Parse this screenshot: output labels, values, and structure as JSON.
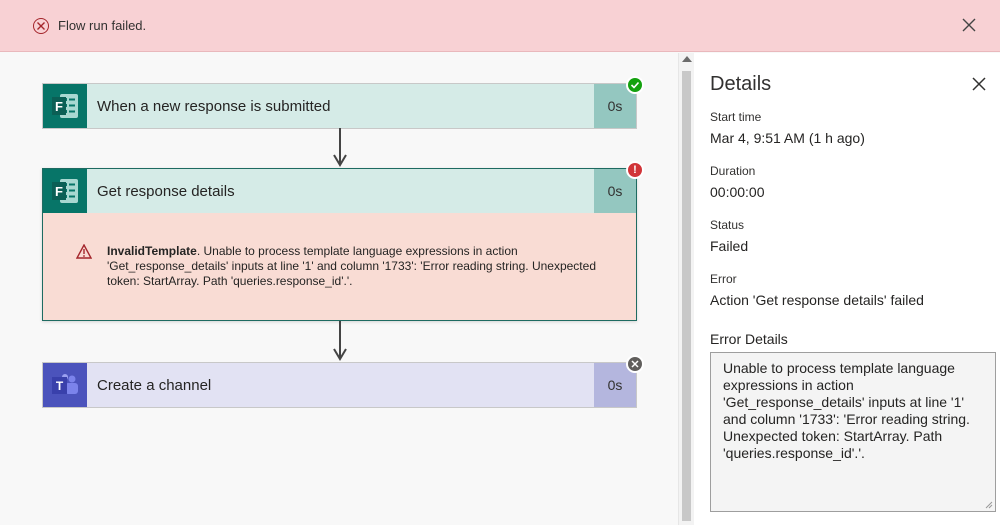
{
  "banner": {
    "message": "Flow run failed.",
    "status_color": "#a4262c"
  },
  "flow": {
    "steps": [
      {
        "title": "When a new response is submitted",
        "duration": "0s",
        "app": "Microsoft Forms",
        "icon": "forms-icon",
        "status": "succeeded",
        "status_icon": "check-icon"
      },
      {
        "title": "Get response details",
        "duration": "0s",
        "app": "Microsoft Forms",
        "icon": "forms-icon",
        "status": "failed",
        "status_icon": "exclamation-icon",
        "error": {
          "code": "InvalidTemplate",
          "message": ". Unable to process template language expressions in action 'Get_response_details' inputs at line '1' and column '1733': 'Error reading string. Unexpected token: StartArray. Path 'queries.response_id'.'."
        }
      },
      {
        "title": "Create a channel",
        "duration": "0s",
        "app": "Microsoft Teams",
        "icon": "teams-icon",
        "status": "skipped",
        "status_icon": "x-icon"
      }
    ]
  },
  "details": {
    "title": "Details",
    "start_time_label": "Start time",
    "start_time_value": "Mar 4, 9:51 AM (1 h ago)",
    "duration_label": "Duration",
    "duration_value": "00:00:00",
    "status_label": "Status",
    "status_value": "Failed",
    "error_label": "Error",
    "error_value": "Action 'Get response details' failed",
    "error_details_label": "Error Details",
    "error_details_text": "Unable to process template language expressions in action 'Get_response_details' inputs at line '1' and column '1733': 'Error reading string. Unexpected token: StartArray. Path 'queries.response_id'.'."
  },
  "colors": {
    "forms_brand": "#077568",
    "teams_brand": "#4b53bc",
    "success": "#13a10e",
    "error": "#d13438",
    "skipped": "#605e5c"
  }
}
